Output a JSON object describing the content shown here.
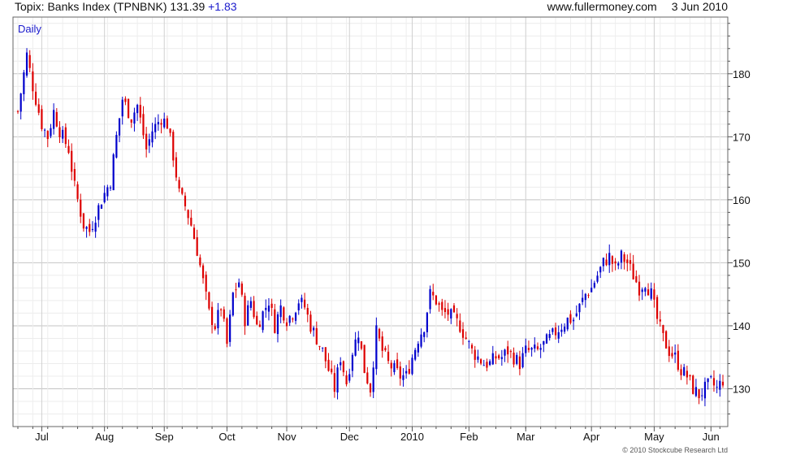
{
  "header": {
    "title": "Topix: Banks Index (TPNBNK)",
    "last": "131.39",
    "change": "+1.83",
    "site": "www.fullermoney.com",
    "date": "3 Jun 2010"
  },
  "copyright": "© 2010 Stockcube Research Ltd",
  "colors": {
    "up": "#0000cc",
    "down": "#dd0000",
    "grid": "#d6d6d6",
    "frame": "#666666",
    "label": "#1a1acc"
  },
  "chart_data": {
    "type": "candlestick",
    "title": "Topix: Banks Index (TPNBNK)",
    "interval_label": "Daily",
    "ylim": [
      124,
      189
    ],
    "y_ticks": [
      130,
      140,
      150,
      160,
      170,
      180
    ],
    "x_month_labels": [
      "Jul",
      "Aug",
      "Sep",
      "Oct",
      "Nov",
      "Dec",
      "2010",
      "Feb",
      "Mar",
      "Apr",
      "May",
      "Jun"
    ],
    "x_month_sessions": [
      8,
      29,
      49,
      70,
      90,
      111,
      132,
      151,
      170,
      192,
      213,
      232
    ],
    "grid": true,
    "y_axis_side": "right",
    "close_path": [
      {
        "s": 0,
        "v": 174
      },
      {
        "s": 3,
        "v": 183
      },
      {
        "s": 5,
        "v": 178
      },
      {
        "s": 8,
        "v": 172
      },
      {
        "s": 10,
        "v": 170
      },
      {
        "s": 12,
        "v": 174
      },
      {
        "s": 14,
        "v": 171
      },
      {
        "s": 17,
        "v": 168
      },
      {
        "s": 19,
        "v": 162
      },
      {
        "s": 22,
        "v": 156
      },
      {
        "s": 24,
        "v": 155
      },
      {
        "s": 28,
        "v": 160
      },
      {
        "s": 31,
        "v": 163
      },
      {
        "s": 33,
        "v": 170
      },
      {
        "s": 35,
        "v": 176
      },
      {
        "s": 38,
        "v": 173
      },
      {
        "s": 40,
        "v": 175
      },
      {
        "s": 43,
        "v": 168
      },
      {
        "s": 45,
        "v": 171
      },
      {
        "s": 48,
        "v": 173
      },
      {
        "s": 50,
        "v": 172
      },
      {
        "s": 52,
        "v": 167
      },
      {
        "s": 54,
        "v": 161
      },
      {
        "s": 56,
        "v": 159
      },
      {
        "s": 58,
        "v": 156
      },
      {
        "s": 60,
        "v": 152
      },
      {
        "s": 62,
        "v": 147
      },
      {
        "s": 64,
        "v": 142
      },
      {
        "s": 66,
        "v": 140
      },
      {
        "s": 68,
        "v": 143
      },
      {
        "s": 70,
        "v": 137
      },
      {
        "s": 72,
        "v": 145
      },
      {
        "s": 74,
        "v": 147
      },
      {
        "s": 76,
        "v": 141
      },
      {
        "s": 78,
        "v": 144
      },
      {
        "s": 80,
        "v": 140
      },
      {
        "s": 82,
        "v": 142
      },
      {
        "s": 84,
        "v": 144
      },
      {
        "s": 86,
        "v": 140
      },
      {
        "s": 88,
        "v": 143
      },
      {
        "s": 90,
        "v": 141
      },
      {
        "s": 92,
        "v": 142
      },
      {
        "s": 94,
        "v": 144
      },
      {
        "s": 96,
        "v": 143
      },
      {
        "s": 98,
        "v": 140
      },
      {
        "s": 100,
        "v": 138
      },
      {
        "s": 102,
        "v": 136
      },
      {
        "s": 104,
        "v": 133
      },
      {
        "s": 106,
        "v": 130
      },
      {
        "s": 108,
        "v": 135
      },
      {
        "s": 110,
        "v": 131
      },
      {
        "s": 112,
        "v": 136
      },
      {
        "s": 114,
        "v": 139
      },
      {
        "s": 116,
        "v": 133
      },
      {
        "s": 118,
        "v": 130
      },
      {
        "s": 120,
        "v": 139
      },
      {
        "s": 122,
        "v": 136
      },
      {
        "s": 124,
        "v": 134
      },
      {
        "s": 126,
        "v": 133
      },
      {
        "s": 128,
        "v": 132
      },
      {
        "s": 130,
        "v": 132
      },
      {
        "s": 132,
        "v": 135
      },
      {
        "s": 134,
        "v": 138
      },
      {
        "s": 136,
        "v": 140
      },
      {
        "s": 138,
        "v": 145
      },
      {
        "s": 140,
        "v": 144
      },
      {
        "s": 142,
        "v": 142
      },
      {
        "s": 144,
        "v": 142
      },
      {
        "s": 146,
        "v": 141
      },
      {
        "s": 148,
        "v": 140
      },
      {
        "s": 150,
        "v": 138
      },
      {
        "s": 152,
        "v": 136
      },
      {
        "s": 154,
        "v": 135
      },
      {
        "s": 156,
        "v": 134
      },
      {
        "s": 158,
        "v": 134
      },
      {
        "s": 160,
        "v": 135
      },
      {
        "s": 162,
        "v": 135
      },
      {
        "s": 164,
        "v": 136
      },
      {
        "s": 166,
        "v": 135
      },
      {
        "s": 168,
        "v": 134
      },
      {
        "s": 170,
        "v": 136
      },
      {
        "s": 172,
        "v": 136
      },
      {
        "s": 174,
        "v": 136
      },
      {
        "s": 176,
        "v": 137
      },
      {
        "s": 178,
        "v": 138
      },
      {
        "s": 180,
        "v": 139
      },
      {
        "s": 182,
        "v": 140
      },
      {
        "s": 184,
        "v": 141
      },
      {
        "s": 186,
        "v": 141
      },
      {
        "s": 188,
        "v": 143
      },
      {
        "s": 190,
        "v": 145
      },
      {
        "s": 192,
        "v": 146
      },
      {
        "s": 194,
        "v": 148
      },
      {
        "s": 196,
        "v": 150
      },
      {
        "s": 198,
        "v": 151
      },
      {
        "s": 200,
        "v": 149
      },
      {
        "s": 202,
        "v": 151
      },
      {
        "s": 204,
        "v": 150
      },
      {
        "s": 206,
        "v": 148
      },
      {
        "s": 208,
        "v": 146
      },
      {
        "s": 210,
        "v": 147
      },
      {
        "s": 212,
        "v": 145
      },
      {
        "s": 214,
        "v": 141
      },
      {
        "s": 216,
        "v": 138
      },
      {
        "s": 218,
        "v": 136
      },
      {
        "s": 220,
        "v": 135
      },
      {
        "s": 222,
        "v": 133
      },
      {
        "s": 224,
        "v": 132
      },
      {
        "s": 226,
        "v": 130
      },
      {
        "s": 228,
        "v": 129
      },
      {
        "s": 230,
        "v": 130
      },
      {
        "s": 232,
        "v": 131
      },
      {
        "s": 234,
        "v": 130
      },
      {
        "s": 236,
        "v": 131.4
      }
    ]
  }
}
